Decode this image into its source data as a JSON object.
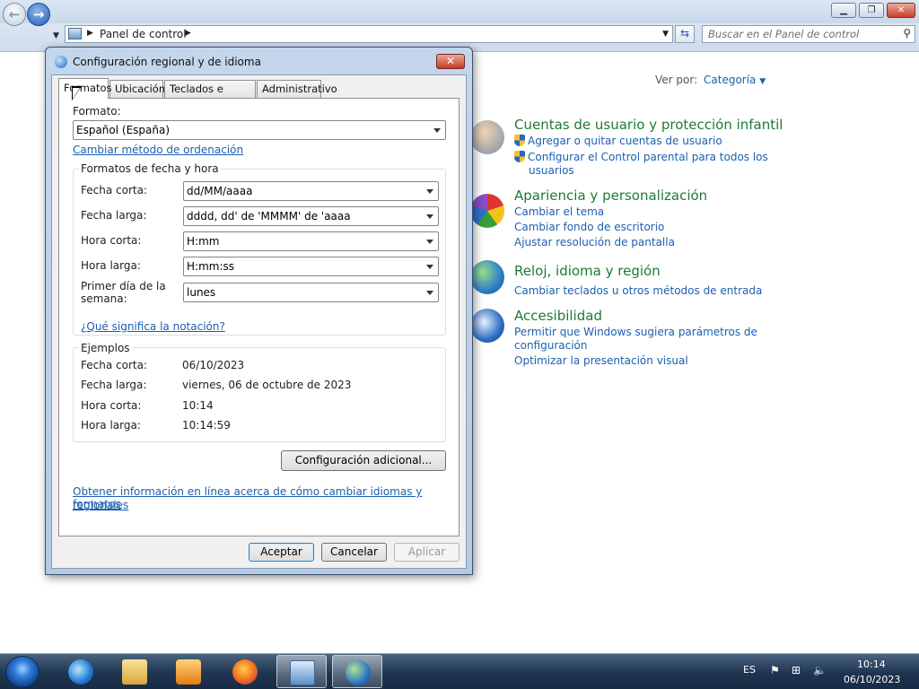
{
  "explorer": {
    "breadcrumb": "Panel de control",
    "search_placeholder": "Buscar en el Panel de control",
    "view_label": "Ver por:",
    "view_value": "Categoría"
  },
  "categories": [
    {
      "heading": "Cuentas de usuario y protección infantil",
      "links": [
        "Agregar o quitar cuentas de usuario",
        "Configurar el Control parental para todos los",
        "usuarios"
      ]
    },
    {
      "heading": "Apariencia y personalización",
      "links": [
        "Cambiar el tema",
        "Cambiar fondo de escritorio",
        "Ajustar resolución de pantalla"
      ]
    },
    {
      "heading": "Reloj, idioma y región",
      "links": [
        "Cambiar teclados u otros métodos de entrada"
      ]
    },
    {
      "heading": "Accesibilidad",
      "links": [
        "Permitir que Windows sugiera parámetros de",
        "configuración",
        "Optimizar la presentación visual"
      ]
    }
  ],
  "dialog": {
    "title": "Configuración regional y de idioma",
    "tabs": [
      "Formatos",
      "Ubicación",
      "Teclados e idiomas",
      "Administrativo"
    ],
    "format_label": "Formato:",
    "format_value": "Español (España)",
    "sort_link": "Cambiar método de ordenación",
    "datetime_group": "Formatos de fecha y hora",
    "fields": [
      {
        "label": "Fecha corta:",
        "value": "dd/MM/aaaa"
      },
      {
        "label": "Fecha larga:",
        "value": "dddd, dd' de 'MMMM' de 'aaaa"
      },
      {
        "label": "Hora corta:",
        "value": "H:mm"
      },
      {
        "label": "Hora larga:",
        "value": "H:mm:ss"
      },
      {
        "label_line1": "Primer día de la",
        "label_line2": "semana:",
        "value": "lunes"
      }
    ],
    "notation_link": "¿Qué significa la notación?",
    "examples_group": "Ejemplos",
    "examples": [
      {
        "label": "Fecha corta:",
        "value": "06/10/2023"
      },
      {
        "label": "Fecha larga:",
        "value": "viernes, 06 de octubre de 2023"
      },
      {
        "label": "Hora corta:",
        "value": "10:14"
      },
      {
        "label": "Hora larga:",
        "value": "10:14:59"
      }
    ],
    "additional_button": "Configuración adicional...",
    "online_link_line1": "Obtener información en línea acerca de cómo cambiar idiomas y formatos",
    "online_link_line2": "regionales",
    "buttons": {
      "ok": "Aceptar",
      "cancel": "Cancelar",
      "apply": "Aplicar"
    }
  },
  "taskbar": {
    "language": "ES",
    "time": "10:14",
    "date": "06/10/2023"
  }
}
